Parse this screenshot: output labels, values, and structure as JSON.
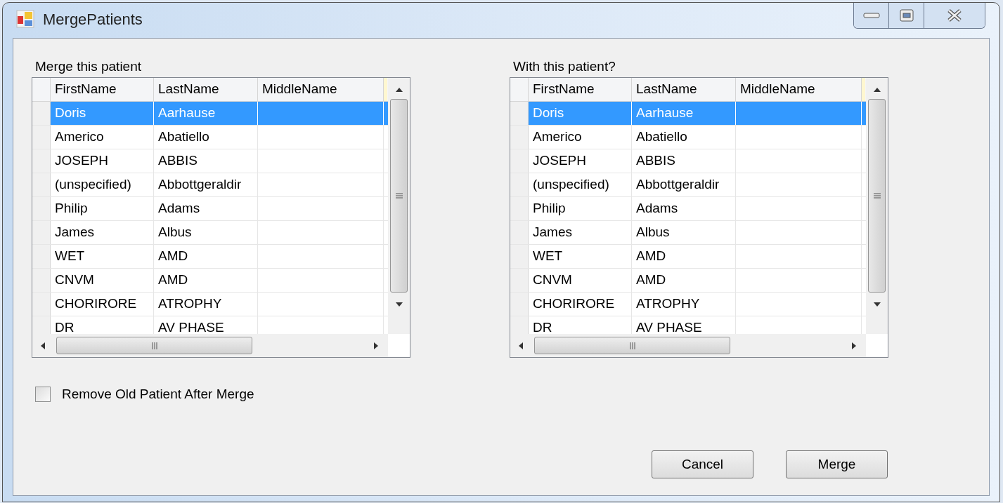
{
  "window": {
    "title": "MergePatients"
  },
  "grids": [
    {
      "label": "Merge this patient",
      "columns": [
        "FirstName",
        "LastName",
        "MiddleName"
      ],
      "rows": [
        {
          "cells": [
            "Doris",
            "Aarhause",
            ""
          ],
          "selected": true
        },
        {
          "cells": [
            "Americo",
            "Abatiello",
            ""
          ],
          "selected": false
        },
        {
          "cells": [
            "JOSEPH",
            "ABBIS",
            ""
          ],
          "selected": false
        },
        {
          "cells": [
            "(unspecified)",
            "Abbottgeraldir",
            ""
          ],
          "selected": false
        },
        {
          "cells": [
            "Philip",
            "Adams",
            ""
          ],
          "selected": false
        },
        {
          "cells": [
            "James",
            "Albus",
            ""
          ],
          "selected": false
        },
        {
          "cells": [
            "WET",
            "AMD",
            ""
          ],
          "selected": false
        },
        {
          "cells": [
            "CNVM",
            "AMD",
            ""
          ],
          "selected": false
        },
        {
          "cells": [
            "CHORIRORE",
            "ATROPHY",
            ""
          ],
          "selected": false
        },
        {
          "cells": [
            "DR",
            "AV PHASE",
            ""
          ],
          "selected": false
        }
      ]
    },
    {
      "label": "With this patient?",
      "columns": [
        "FirstName",
        "LastName",
        "MiddleName"
      ],
      "rows": [
        {
          "cells": [
            "Doris",
            "Aarhause",
            ""
          ],
          "selected": true
        },
        {
          "cells": [
            "Americo",
            "Abatiello",
            ""
          ],
          "selected": false
        },
        {
          "cells": [
            "JOSEPH",
            "ABBIS",
            ""
          ],
          "selected": false
        },
        {
          "cells": [
            "(unspecified)",
            "Abbottgeraldir",
            ""
          ],
          "selected": false
        },
        {
          "cells": [
            "Philip",
            "Adams",
            ""
          ],
          "selected": false
        },
        {
          "cells": [
            "James",
            "Albus",
            ""
          ],
          "selected": false
        },
        {
          "cells": [
            "WET",
            "AMD",
            ""
          ],
          "selected": false
        },
        {
          "cells": [
            "CNVM",
            "AMD",
            ""
          ],
          "selected": false
        },
        {
          "cells": [
            "CHORIRORE",
            "ATROPHY",
            ""
          ],
          "selected": false
        },
        {
          "cells": [
            "DR",
            "AV PHASE",
            ""
          ],
          "selected": false
        }
      ]
    }
  ],
  "remove_old": {
    "label": "Remove Old Patient After Merge",
    "checked": false
  },
  "buttons": [
    "Cancel",
    "Merge"
  ]
}
